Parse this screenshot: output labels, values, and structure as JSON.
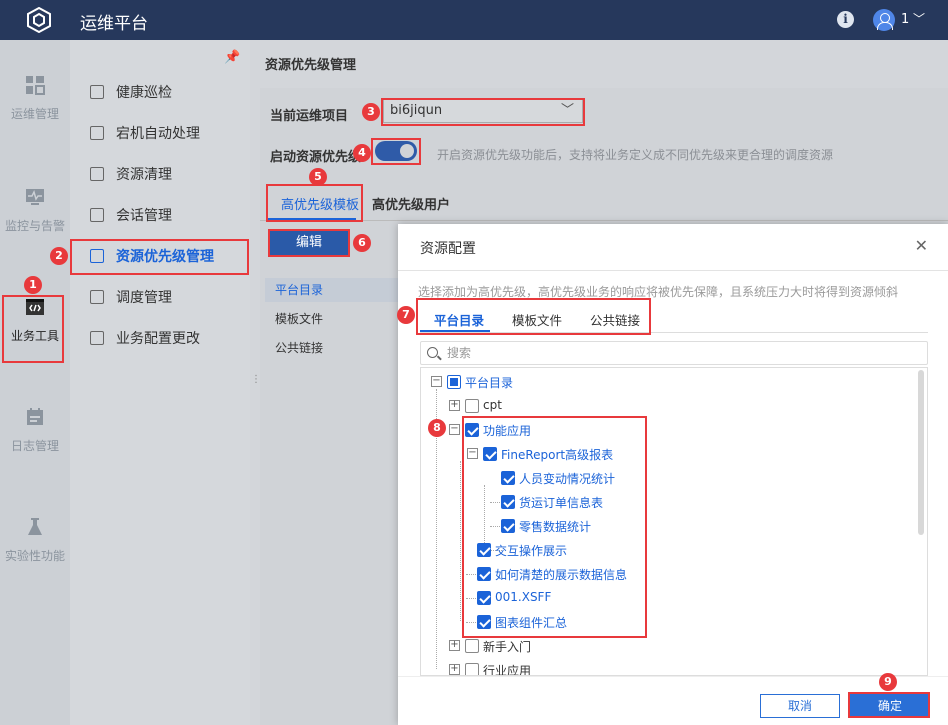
{
  "app": {
    "title": "运维平台",
    "user": "1"
  },
  "rail": [
    {
      "label": "运维管理",
      "icon": "dashboard-icon"
    },
    {
      "label": "监控与告警",
      "icon": "monitor-icon"
    },
    {
      "label": "业务工具",
      "icon": "code-icon",
      "active": true
    },
    {
      "label": "日志管理",
      "icon": "calendar-icon"
    },
    {
      "label": "实验性功能",
      "icon": "flask-icon"
    }
  ],
  "nav": {
    "items": [
      {
        "label": "健康巡检",
        "icon": "chart-icon"
      },
      {
        "label": "宕机自动处理",
        "icon": "wrench-icon"
      },
      {
        "label": "资源清理",
        "icon": "clean-icon"
      },
      {
        "label": "会话管理",
        "icon": "session-icon"
      },
      {
        "label": "资源优先级管理",
        "icon": "priority-icon",
        "active": true
      },
      {
        "label": "调度管理",
        "icon": "schedule-icon"
      },
      {
        "label": "业务配置更改",
        "icon": "config-icon"
      }
    ]
  },
  "main": {
    "page_title": "资源优先级管理",
    "project_label": "当前运维项目",
    "project_value": "bi6jiqun",
    "toggle_label": "启动资源优先级",
    "toggle_on": true,
    "toggle_desc": "开启资源优先级功能后，支持将业务定义成不同优先级来更合理的调度资源",
    "tabs": [
      "高优先级模板",
      "高优先级用户"
    ],
    "edit_label": "编辑",
    "side_items": [
      "平台目录",
      "模板文件",
      "公共链接"
    ]
  },
  "dialog": {
    "title": "资源配置",
    "desc": "选择添加为高优先级，高优先级业务的响应将被优先保障，且系统压力大时将得到资源倾斜",
    "tabs": [
      "平台目录",
      "模板文件",
      "公共链接"
    ],
    "search_placeholder": "搜索",
    "tree": {
      "root": "平台目录",
      "cpt": "cpt",
      "func": "功能应用",
      "fr": "FineReport高级报表",
      "c1": "人员变动情况统计",
      "c2": "货运订单信息表",
      "c3": "零售数据统计",
      "f2": "交互操作展示",
      "f3": "如何清楚的展示数据信息",
      "f4": "001.XSFF",
      "f5": "图表组件汇总",
      "n1": "新手入门",
      "n2": "行业应用"
    },
    "cancel": "取消",
    "ok": "确定"
  },
  "markers": [
    "1",
    "2",
    "3",
    "4",
    "5",
    "6",
    "7",
    "8",
    "9"
  ]
}
